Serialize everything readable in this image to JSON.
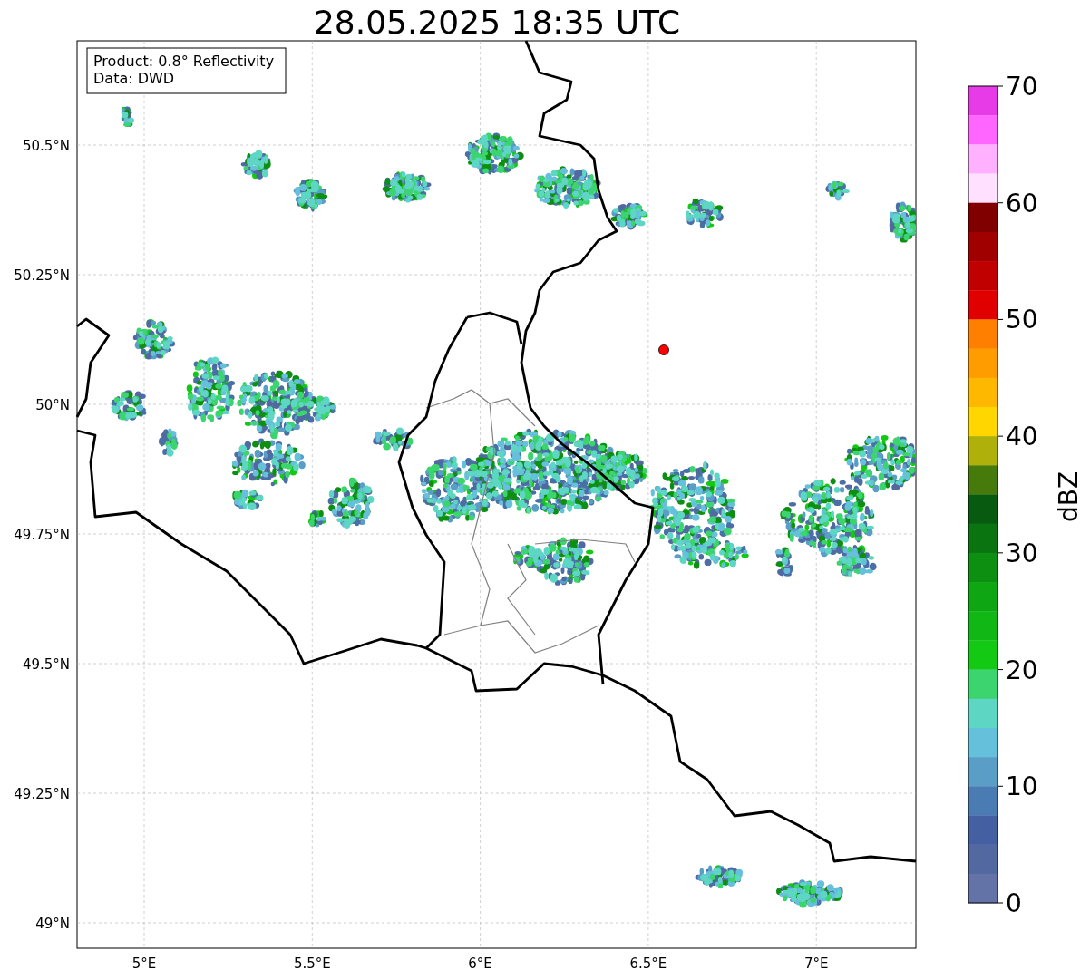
{
  "title": "28.05.2025 18:35 UTC",
  "legend": [
    "Product: 0.8° Reflectivity",
    "Data: DWD"
  ],
  "lat_ticks": [
    "50.5°N",
    "50.25°N",
    "50°N",
    "49.75°N",
    "49.5°N",
    "49.25°N",
    "49°N"
  ],
  "lon_ticks": [
    "5°E",
    "5.5°E",
    "6°E",
    "6.5°E",
    "7°E"
  ],
  "colorbar": {
    "label": "dBZ",
    "ticks": [
      "70",
      "60",
      "50",
      "40",
      "30",
      "20",
      "10",
      "0"
    ],
    "segments": [
      {
        "color": "#e83be8"
      },
      {
        "color": "#ff66ff"
      },
      {
        "color": "#ffb0ff"
      },
      {
        "color": "#ffe0ff"
      },
      {
        "color": "#800000"
      },
      {
        "color": "#a00000"
      },
      {
        "color": "#c00000"
      },
      {
        "color": "#e00000"
      },
      {
        "color": "#ff7f00"
      },
      {
        "color": "#ff9c00"
      },
      {
        "color": "#ffb800"
      },
      {
        "color": "#ffd600"
      },
      {
        "color": "#afb00a"
      },
      {
        "color": "#467a0a"
      },
      {
        "color": "#075a10"
      },
      {
        "color": "#0a7510"
      },
      {
        "color": "#0d8f12"
      },
      {
        "color": "#0fa613"
      },
      {
        "color": "#11b815"
      },
      {
        "color": "#13c913"
      },
      {
        "color": "#3cd46e"
      },
      {
        "color": "#5ed6c4"
      },
      {
        "color": "#65c0dc"
      },
      {
        "color": "#5a9ec8"
      },
      {
        "color": "#4a7bb3"
      },
      {
        "color": "#4460a3"
      },
      {
        "color": "#5268a0"
      },
      {
        "color": "#6373a8"
      }
    ]
  }
}
